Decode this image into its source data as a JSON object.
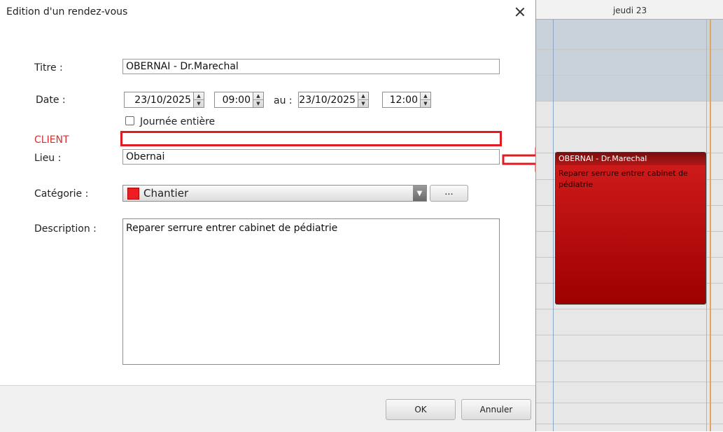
{
  "dialog": {
    "title": "Edition d'un rendez-vous",
    "labels": {
      "titre": "Titre :",
      "date": "Date :",
      "au": "au :",
      "journee": "Journée entière",
      "client": "CLIENT",
      "lieu": "Lieu :",
      "categorie": "Catégorie :",
      "description": "Description :"
    },
    "fields": {
      "titre": "OBERNAI - Dr.Marechal",
      "date_start": "23/10/2025",
      "time_start": "09:00",
      "date_end": "23/10/2025",
      "time_end": "12:00",
      "journee_entiere": false,
      "client": "",
      "lieu": "Obernai",
      "categorie": "Chantier",
      "categorie_color": "#ee1c24",
      "description": "Reparer serrure entrer cabinet de pédiatrie"
    },
    "more_label": "...",
    "buttons": {
      "ok": "OK",
      "cancel": "Annuler"
    }
  },
  "calendar": {
    "day_header": "jeudi 23",
    "event": {
      "title": "OBERNAI - Dr.Marechal",
      "description": "Reparer serrure entrer cabinet de pédiatrie",
      "color": "#c01010"
    }
  },
  "annotation": {
    "highlight_color": "#e01b22"
  }
}
